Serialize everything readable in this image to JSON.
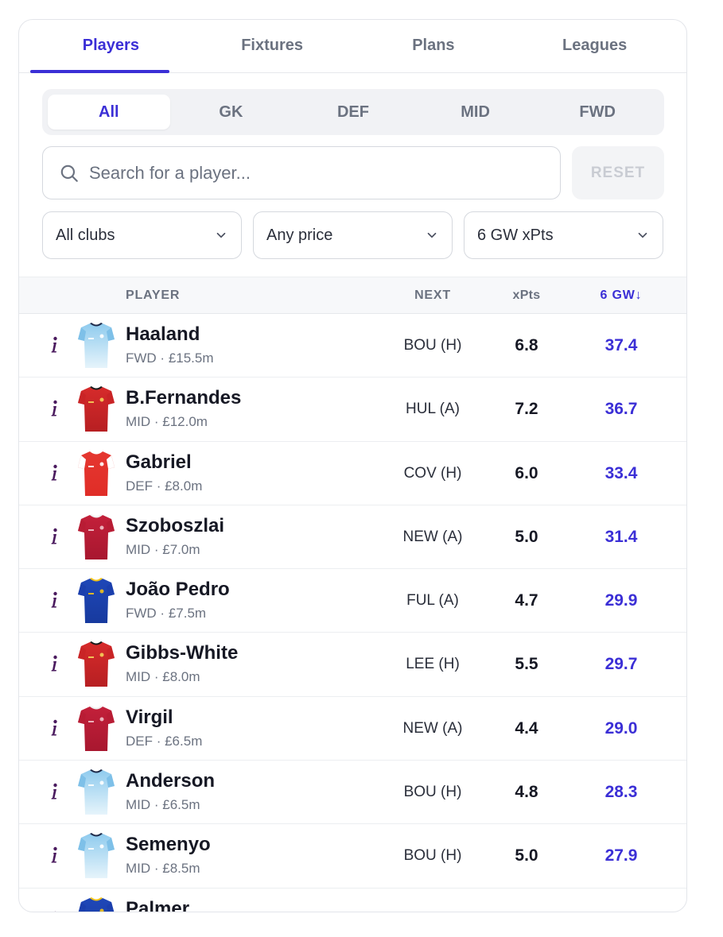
{
  "tabs": [
    "Players",
    "Fixtures",
    "Plans",
    "Leagues"
  ],
  "positions": [
    "All",
    "GK",
    "DEF",
    "MID",
    "FWD"
  ],
  "search": {
    "placeholder": "Search for a player...",
    "reset_label": "RESET"
  },
  "filters": {
    "club": "All clubs",
    "price": "Any price",
    "sort": "6 GW xPts"
  },
  "table": {
    "col_player": "PLAYER",
    "col_next": "NEXT",
    "col_xpts": "xPts",
    "col_6gw": "6 GW↓"
  },
  "colors": {
    "accent": "#3b2fd6",
    "info_icon": "#4a1a5e"
  },
  "players": [
    {
      "name": "Haaland",
      "meta": "FWD · £15.5m",
      "next": "BOU (H)",
      "xpts": "6.8",
      "gw6": "37.4",
      "shirt": "sky"
    },
    {
      "name": "B.Fernandes",
      "meta": "MID · £12.0m",
      "next": "HUL (A)",
      "xpts": "7.2",
      "gw6": "36.7",
      "shirt": "red"
    },
    {
      "name": "Gabriel",
      "meta": "DEF · £8.0m",
      "next": "COV (H)",
      "xpts": "6.0",
      "gw6": "33.4",
      "shirt": "redwhite"
    },
    {
      "name": "Szoboszlai",
      "meta": "MID · £7.0m",
      "next": "NEW (A)",
      "xpts": "5.0",
      "gw6": "31.4",
      "shirt": "crimson"
    },
    {
      "name": "João Pedro",
      "meta": "FWD · £7.5m",
      "next": "FUL (A)",
      "xpts": "4.7",
      "gw6": "29.9",
      "shirt": "blue"
    },
    {
      "name": "Gibbs-White",
      "meta": "MID · £8.0m",
      "next": "LEE (H)",
      "xpts": "5.5",
      "gw6": "29.7",
      "shirt": "red"
    },
    {
      "name": "Virgil",
      "meta": "DEF · £6.5m",
      "next": "NEW (A)",
      "xpts": "4.4",
      "gw6": "29.0",
      "shirt": "crimson"
    },
    {
      "name": "Anderson",
      "meta": "MID · £6.5m",
      "next": "BOU (H)",
      "xpts": "4.8",
      "gw6": "28.3",
      "shirt": "sky"
    },
    {
      "name": "Semenyo",
      "meta": "MID · £8.5m",
      "next": "BOU (H)",
      "xpts": "5.0",
      "gw6": "27.9",
      "shirt": "sky"
    },
    {
      "name": "Palmer",
      "meta": "",
      "next": "",
      "xpts": "",
      "gw6": "",
      "shirt": "blue"
    }
  ]
}
